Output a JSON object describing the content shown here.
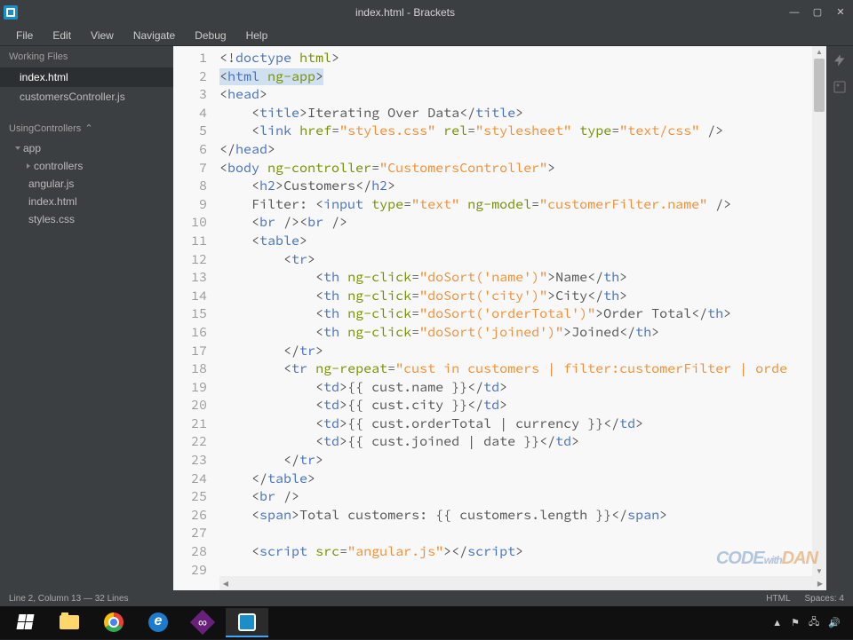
{
  "window": {
    "title": "index.html - Brackets"
  },
  "menu": [
    "File",
    "Edit",
    "View",
    "Navigate",
    "Debug",
    "Help"
  ],
  "sidebar": {
    "working_files_label": "Working Files",
    "working_files": [
      "index.html",
      "customersController.js"
    ],
    "project_label": "UsingControllers",
    "tree": {
      "folder": "app",
      "subfolder": "controllers",
      "files": [
        "angular.js",
        "index.html",
        "styles.css"
      ]
    }
  },
  "editor": {
    "lines": [
      {
        "n": 1,
        "tokens": [
          [
            "punct",
            "<!"
          ],
          [
            "kw",
            "doctype"
          ],
          [
            "text",
            " "
          ],
          [
            "attr",
            "html"
          ],
          [
            "punct",
            ">"
          ]
        ]
      },
      {
        "n": 2,
        "hl": true,
        "tokens": [
          [
            "punct",
            "<"
          ],
          [
            "kw",
            "html"
          ],
          [
            "text",
            " "
          ],
          [
            "attr",
            "ng-app"
          ],
          [
            "punct",
            ">"
          ]
        ]
      },
      {
        "n": 3,
        "tokens": [
          [
            "punct",
            "<"
          ],
          [
            "kw",
            "head"
          ],
          [
            "punct",
            ">"
          ]
        ]
      },
      {
        "n": 4,
        "tokens": [
          [
            "text",
            "    "
          ],
          [
            "punct",
            "<"
          ],
          [
            "kw",
            "title"
          ],
          [
            "punct",
            ">"
          ],
          [
            "text",
            "Iterating Over Data"
          ],
          [
            "punct",
            "</"
          ],
          [
            "kw",
            "title"
          ],
          [
            "punct",
            ">"
          ]
        ]
      },
      {
        "n": 5,
        "tokens": [
          [
            "text",
            "    "
          ],
          [
            "punct",
            "<"
          ],
          [
            "kw",
            "link"
          ],
          [
            "text",
            " "
          ],
          [
            "attr",
            "href"
          ],
          [
            "punct",
            "="
          ],
          [
            "str",
            "\"styles.css\""
          ],
          [
            "text",
            " "
          ],
          [
            "attr",
            "rel"
          ],
          [
            "punct",
            "="
          ],
          [
            "str",
            "\"stylesheet\""
          ],
          [
            "text",
            " "
          ],
          [
            "attr",
            "type"
          ],
          [
            "punct",
            "="
          ],
          [
            "str",
            "\"text/css\""
          ],
          [
            "text",
            " "
          ],
          [
            "punct",
            "/>"
          ]
        ]
      },
      {
        "n": 6,
        "tokens": [
          [
            "punct",
            "</"
          ],
          [
            "kw",
            "head"
          ],
          [
            "punct",
            ">"
          ]
        ]
      },
      {
        "n": 7,
        "tokens": [
          [
            "punct",
            "<"
          ],
          [
            "kw",
            "body"
          ],
          [
            "text",
            " "
          ],
          [
            "attr",
            "ng-controller"
          ],
          [
            "punct",
            "="
          ],
          [
            "str",
            "\"CustomersController\""
          ],
          [
            "punct",
            ">"
          ]
        ]
      },
      {
        "n": 8,
        "tokens": [
          [
            "text",
            "    "
          ],
          [
            "punct",
            "<"
          ],
          [
            "kw",
            "h2"
          ],
          [
            "punct",
            ">"
          ],
          [
            "text",
            "Customers"
          ],
          [
            "punct",
            "</"
          ],
          [
            "kw",
            "h2"
          ],
          [
            "punct",
            ">"
          ]
        ]
      },
      {
        "n": 9,
        "tokens": [
          [
            "text",
            "    Filter: "
          ],
          [
            "punct",
            "<"
          ],
          [
            "kw",
            "input"
          ],
          [
            "text",
            " "
          ],
          [
            "attr",
            "type"
          ],
          [
            "punct",
            "="
          ],
          [
            "str",
            "\"text\""
          ],
          [
            "text",
            " "
          ],
          [
            "attr",
            "ng-model"
          ],
          [
            "punct",
            "="
          ],
          [
            "str",
            "\"customerFilter.name\""
          ],
          [
            "text",
            " "
          ],
          [
            "punct",
            "/>"
          ]
        ]
      },
      {
        "n": 10,
        "tokens": [
          [
            "text",
            "    "
          ],
          [
            "punct",
            "<"
          ],
          [
            "kw",
            "br"
          ],
          [
            "text",
            " "
          ],
          [
            "punct",
            "/><"
          ],
          [
            "kw",
            "br"
          ],
          [
            "text",
            " "
          ],
          [
            "punct",
            "/>"
          ]
        ]
      },
      {
        "n": 11,
        "tokens": [
          [
            "text",
            "    "
          ],
          [
            "punct",
            "<"
          ],
          [
            "kw",
            "table"
          ],
          [
            "punct",
            ">"
          ]
        ]
      },
      {
        "n": 12,
        "tokens": [
          [
            "text",
            "        "
          ],
          [
            "punct",
            "<"
          ],
          [
            "kw",
            "tr"
          ],
          [
            "punct",
            ">"
          ]
        ]
      },
      {
        "n": 13,
        "tokens": [
          [
            "text",
            "            "
          ],
          [
            "punct",
            "<"
          ],
          [
            "kw",
            "th"
          ],
          [
            "text",
            " "
          ],
          [
            "attr",
            "ng-click"
          ],
          [
            "punct",
            "="
          ],
          [
            "str",
            "\"doSort('name')\""
          ],
          [
            "punct",
            ">"
          ],
          [
            "text",
            "Name"
          ],
          [
            "punct",
            "</"
          ],
          [
            "kw",
            "th"
          ],
          [
            "punct",
            ">"
          ]
        ]
      },
      {
        "n": 14,
        "tokens": [
          [
            "text",
            "            "
          ],
          [
            "punct",
            "<"
          ],
          [
            "kw",
            "th"
          ],
          [
            "text",
            " "
          ],
          [
            "attr",
            "ng-click"
          ],
          [
            "punct",
            "="
          ],
          [
            "str",
            "\"doSort('city')\""
          ],
          [
            "punct",
            ">"
          ],
          [
            "text",
            "City"
          ],
          [
            "punct",
            "</"
          ],
          [
            "kw",
            "th"
          ],
          [
            "punct",
            ">"
          ]
        ]
      },
      {
        "n": 15,
        "tokens": [
          [
            "text",
            "            "
          ],
          [
            "punct",
            "<"
          ],
          [
            "kw",
            "th"
          ],
          [
            "text",
            " "
          ],
          [
            "attr",
            "ng-click"
          ],
          [
            "punct",
            "="
          ],
          [
            "str",
            "\"doSort('orderTotal')\""
          ],
          [
            "punct",
            ">"
          ],
          [
            "text",
            "Order Total"
          ],
          [
            "punct",
            "</"
          ],
          [
            "kw",
            "th"
          ],
          [
            "punct",
            ">"
          ]
        ]
      },
      {
        "n": 16,
        "tokens": [
          [
            "text",
            "            "
          ],
          [
            "punct",
            "<"
          ],
          [
            "kw",
            "th"
          ],
          [
            "text",
            " "
          ],
          [
            "attr",
            "ng-click"
          ],
          [
            "punct",
            "="
          ],
          [
            "str",
            "\"doSort('joined')\""
          ],
          [
            "punct",
            ">"
          ],
          [
            "text",
            "Joined"
          ],
          [
            "punct",
            "</"
          ],
          [
            "kw",
            "th"
          ],
          [
            "punct",
            ">"
          ]
        ]
      },
      {
        "n": 17,
        "tokens": [
          [
            "text",
            "        "
          ],
          [
            "punct",
            "</"
          ],
          [
            "kw",
            "tr"
          ],
          [
            "punct",
            ">"
          ]
        ]
      },
      {
        "n": 18,
        "tokens": [
          [
            "text",
            "        "
          ],
          [
            "punct",
            "<"
          ],
          [
            "kw",
            "tr"
          ],
          [
            "text",
            " "
          ],
          [
            "attr",
            "ng-repeat"
          ],
          [
            "punct",
            "="
          ],
          [
            "str",
            "\"cust in customers | filter:customerFilter | orde"
          ]
        ]
      },
      {
        "n": 19,
        "tokens": [
          [
            "text",
            "            "
          ],
          [
            "punct",
            "<"
          ],
          [
            "kw",
            "td"
          ],
          [
            "punct",
            ">"
          ],
          [
            "text",
            "{{ cust.name }}"
          ],
          [
            "punct",
            "</"
          ],
          [
            "kw",
            "td"
          ],
          [
            "punct",
            ">"
          ]
        ]
      },
      {
        "n": 20,
        "tokens": [
          [
            "text",
            "            "
          ],
          [
            "punct",
            "<"
          ],
          [
            "kw",
            "td"
          ],
          [
            "punct",
            ">"
          ],
          [
            "text",
            "{{ cust.city }}"
          ],
          [
            "punct",
            "</"
          ],
          [
            "kw",
            "td"
          ],
          [
            "punct",
            ">"
          ]
        ]
      },
      {
        "n": 21,
        "tokens": [
          [
            "text",
            "            "
          ],
          [
            "punct",
            "<"
          ],
          [
            "kw",
            "td"
          ],
          [
            "punct",
            ">"
          ],
          [
            "text",
            "{{ cust.orderTotal | currency }}"
          ],
          [
            "punct",
            "</"
          ],
          [
            "kw",
            "td"
          ],
          [
            "punct",
            ">"
          ]
        ]
      },
      {
        "n": 22,
        "tokens": [
          [
            "text",
            "            "
          ],
          [
            "punct",
            "<"
          ],
          [
            "kw",
            "td"
          ],
          [
            "punct",
            ">"
          ],
          [
            "text",
            "{{ cust.joined | date }}"
          ],
          [
            "punct",
            "</"
          ],
          [
            "kw",
            "td"
          ],
          [
            "punct",
            ">"
          ]
        ]
      },
      {
        "n": 23,
        "tokens": [
          [
            "text",
            "        "
          ],
          [
            "punct",
            "</"
          ],
          [
            "kw",
            "tr"
          ],
          [
            "punct",
            ">"
          ]
        ]
      },
      {
        "n": 24,
        "tokens": [
          [
            "text",
            "    "
          ],
          [
            "punct",
            "</"
          ],
          [
            "kw",
            "table"
          ],
          [
            "punct",
            ">"
          ]
        ]
      },
      {
        "n": 25,
        "tokens": [
          [
            "text",
            "    "
          ],
          [
            "punct",
            "<"
          ],
          [
            "kw",
            "br"
          ],
          [
            "text",
            " "
          ],
          [
            "punct",
            "/>"
          ]
        ]
      },
      {
        "n": 26,
        "tokens": [
          [
            "text",
            "    "
          ],
          [
            "punct",
            "<"
          ],
          [
            "kw",
            "span"
          ],
          [
            "punct",
            ">"
          ],
          [
            "text",
            "Total customers: {{ customers.length }}"
          ],
          [
            "punct",
            "</"
          ],
          [
            "kw",
            "span"
          ],
          [
            "punct",
            ">"
          ]
        ]
      },
      {
        "n": 27,
        "tokens": []
      },
      {
        "n": 28,
        "tokens": [
          [
            "text",
            "    "
          ],
          [
            "punct",
            "<"
          ],
          [
            "kw",
            "script"
          ],
          [
            "text",
            " "
          ],
          [
            "attr",
            "src"
          ],
          [
            "punct",
            "="
          ],
          [
            "str",
            "\"angular.js\""
          ],
          [
            "punct",
            "></"
          ],
          [
            "kw",
            "script"
          ],
          [
            "punct",
            ">"
          ]
        ]
      },
      {
        "n": 29,
        "tokens": [
          [
            "text",
            "    "
          ]
        ]
      }
    ]
  },
  "status": {
    "cursor": "Line 2, Column 13 — 32 Lines",
    "lang": "HTML",
    "spaces": "Spaces: 4"
  },
  "watermark": {
    "a": "CODE",
    "b": "with",
    "c": "DAN"
  }
}
